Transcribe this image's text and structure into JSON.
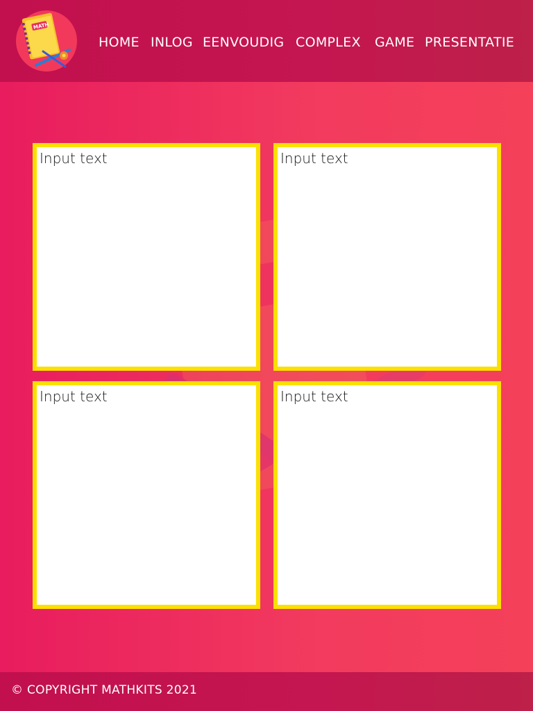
{
  "header": {
    "logo_label": "MATH",
    "nav": [
      {
        "label": "HOME"
      },
      {
        "label": "INLOG"
      },
      {
        "label": "EENVOUDIG"
      },
      {
        "label": "COMPLEX"
      },
      {
        "label": "GAME"
      },
      {
        "label": "PRESENTATIE"
      }
    ]
  },
  "boxes": [
    {
      "placeholder": "Input text"
    },
    {
      "placeholder": "Input text"
    },
    {
      "placeholder": "Input text"
    },
    {
      "placeholder": "Input text"
    }
  ],
  "footer": {
    "copyright": "© COPYRIGHT MATHKITS 2021"
  },
  "colors": {
    "header": "#c2104e",
    "background": "#ef2f5c",
    "box_border": "#fbe000",
    "logo_bg": "#f2395c"
  }
}
